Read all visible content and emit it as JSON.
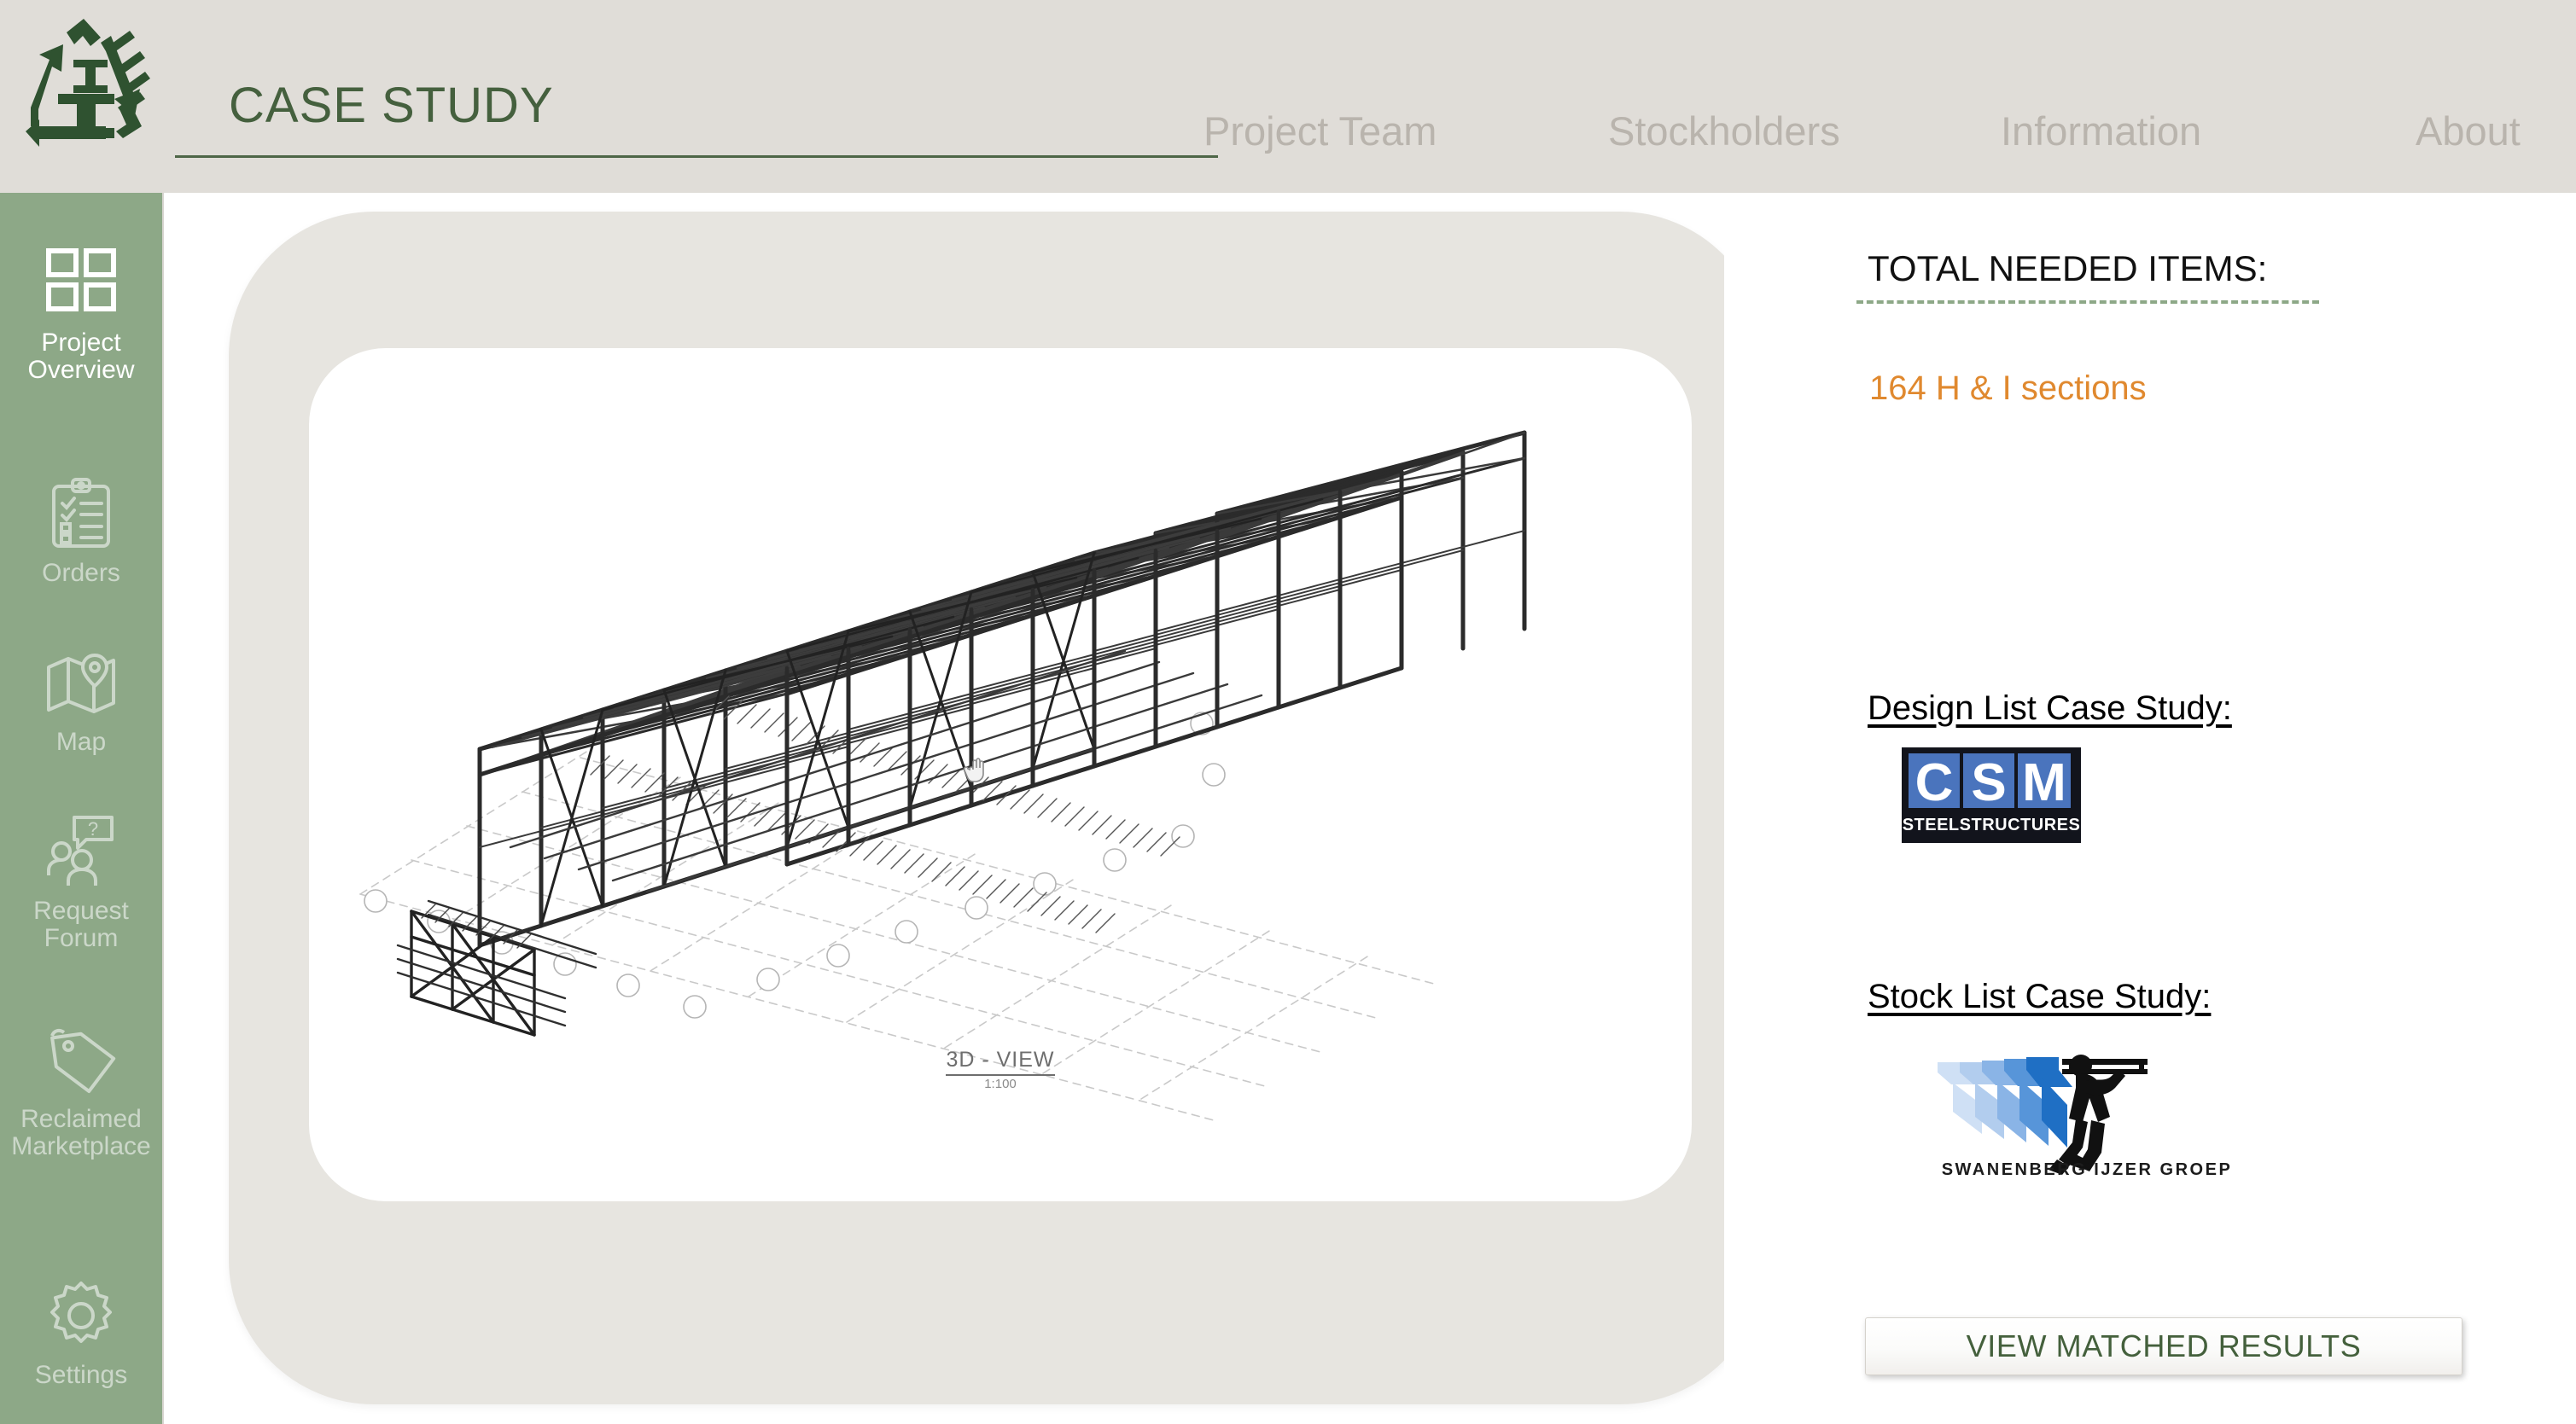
{
  "header": {
    "title": "CASE STUDY",
    "logo_icon": "recycled-steel-logo",
    "nav": [
      {
        "label": "Project Team",
        "name": "nav-project-team"
      },
      {
        "label": "Stockholders",
        "name": "nav-stockholders"
      },
      {
        "label": "Information",
        "name": "nav-information"
      },
      {
        "label": "About",
        "name": "nav-about"
      }
    ]
  },
  "colors": {
    "header_bg": "#e0ddd8",
    "sidebar_bg": "#8da887",
    "brand_green": "#45603e",
    "accent_orange": "#e0892f",
    "panel_gray": "#e7e5e0",
    "nav_text": "#b9b4ad"
  },
  "sidebar": {
    "items": [
      {
        "label": "Project\nOverview",
        "icon": "grid-icon",
        "active": true
      },
      {
        "label": "Orders",
        "icon": "clipboard-checklist-icon",
        "active": false
      },
      {
        "label": "Map",
        "icon": "map-pin-icon",
        "active": false
      },
      {
        "label": "Request\nForum",
        "icon": "people-question-icon",
        "active": false
      },
      {
        "label": "Reclaimed\nMarketplace",
        "icon": "price-tag-icon",
        "active": false
      },
      {
        "label": "Settings",
        "icon": "gear-icon",
        "active": false
      }
    ]
  },
  "main": {
    "drawing": {
      "caption_title": "3D - VIEW",
      "caption_scale": "1:100",
      "icon": "steel-structure-isometric-drawing"
    }
  },
  "right_panel": {
    "needed_title": "TOTAL NEEDED ITEMS:",
    "needed_value": "164 H & I sections",
    "design_list_label": "Design List Case Study:",
    "design_list_logo": {
      "icon": "csm-steelstructures-logo",
      "letters": [
        "C",
        "S",
        "M"
      ],
      "wordmark": "STEELSTRUCTURES"
    },
    "stock_list_label": "Stock List Case Study:",
    "stock_list_logo": {
      "icon": "swanenberg-ijzer-groep-logo",
      "wordmark": "SWANENBERG IJZER GROEP"
    },
    "view_results_button": "VIEW MATCHED RESULTS"
  }
}
